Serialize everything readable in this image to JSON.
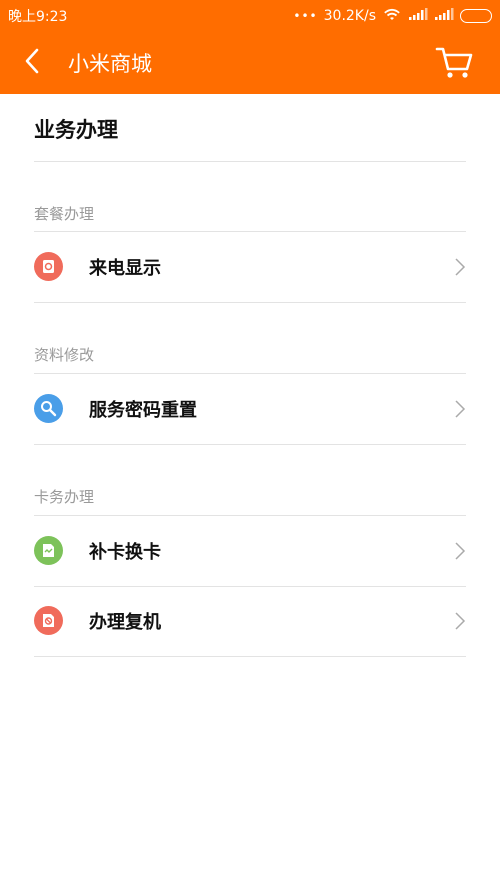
{
  "status": {
    "time": "晚上9:23",
    "dots": "•••",
    "net_speed": "30.2K/s"
  },
  "appbar": {
    "title": "小米商城",
    "back_icon": "back-chevron-icon",
    "cart_icon": "shopping-cart-icon"
  },
  "page": {
    "title": "业务办理"
  },
  "sections": [
    {
      "title": "套餐办理",
      "items": [
        {
          "label": "来电显示",
          "icon": "caller-id-icon",
          "color": "#f06b5b"
        }
      ]
    },
    {
      "title": "资料修改",
      "items": [
        {
          "label": "服务密码重置",
          "icon": "search-key-icon",
          "color": "#4a9ee8"
        }
      ]
    },
    {
      "title": "卡务办理",
      "items": [
        {
          "label": "补卡换卡",
          "icon": "sim-card-icon",
          "color": "#7dc25a"
        },
        {
          "label": "办理复机",
          "icon": "sim-restore-icon",
          "color": "#f06b5b"
        }
      ]
    }
  ],
  "colors": {
    "header": "#ff6d00",
    "section_title": "#9a9a9a",
    "divider": "#e3e3e3"
  }
}
